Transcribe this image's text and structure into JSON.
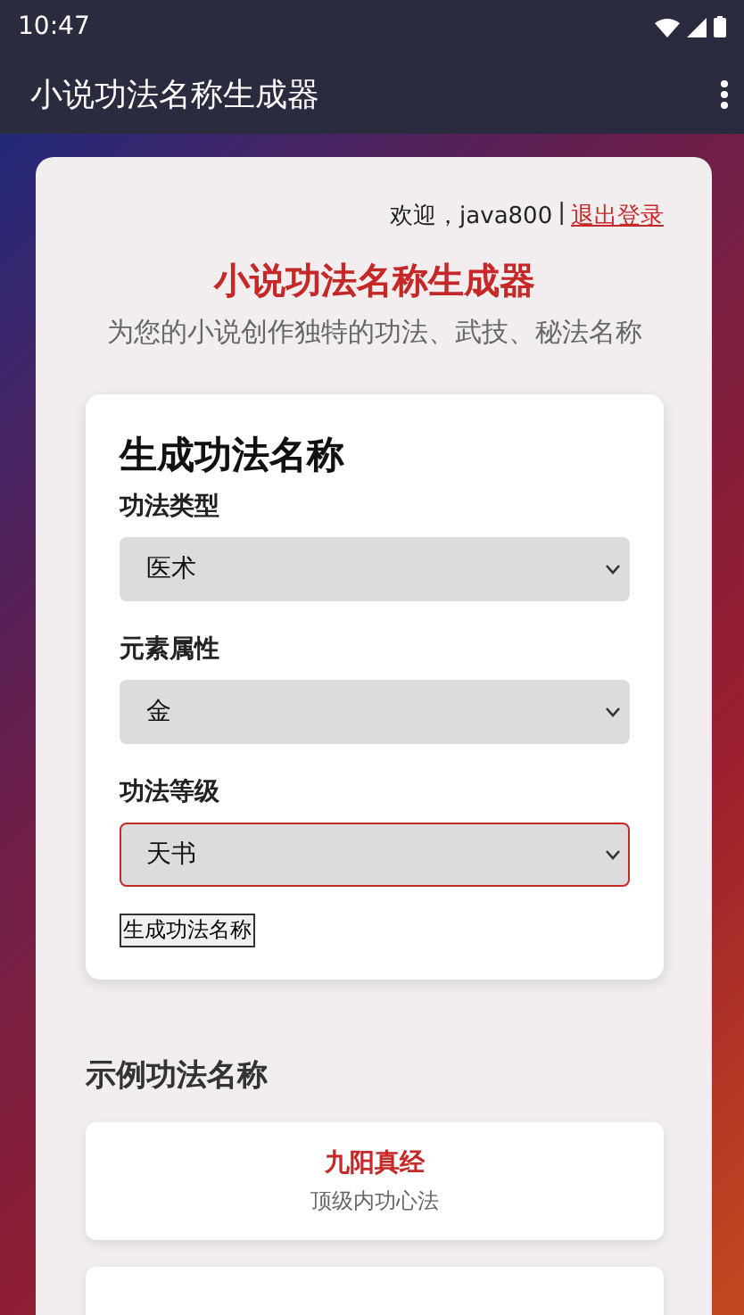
{
  "status_bar": {
    "time": "10:47"
  },
  "app_bar": {
    "title": "小说功法名称生成器"
  },
  "header": {
    "welcome": "欢迎，java800",
    "separator": "|",
    "logout": "退出登录",
    "title": "小说功法名称生成器",
    "subtitle": "为您的小说创作独特的功法、武技、秘法名称"
  },
  "form": {
    "title": "生成功法名称",
    "fields": [
      {
        "label": "功法类型",
        "value": "医术",
        "focused": false
      },
      {
        "label": "元素属性",
        "value": "金",
        "focused": false
      },
      {
        "label": "功法等级",
        "value": "天书",
        "focused": true
      }
    ],
    "button": "生成功法名称"
  },
  "examples": {
    "title": "示例功法名称",
    "items": [
      {
        "kind": "full",
        "name": "九阳真经",
        "description": "顶级内功心法"
      },
      {
        "kind": "cut"
      }
    ]
  }
}
